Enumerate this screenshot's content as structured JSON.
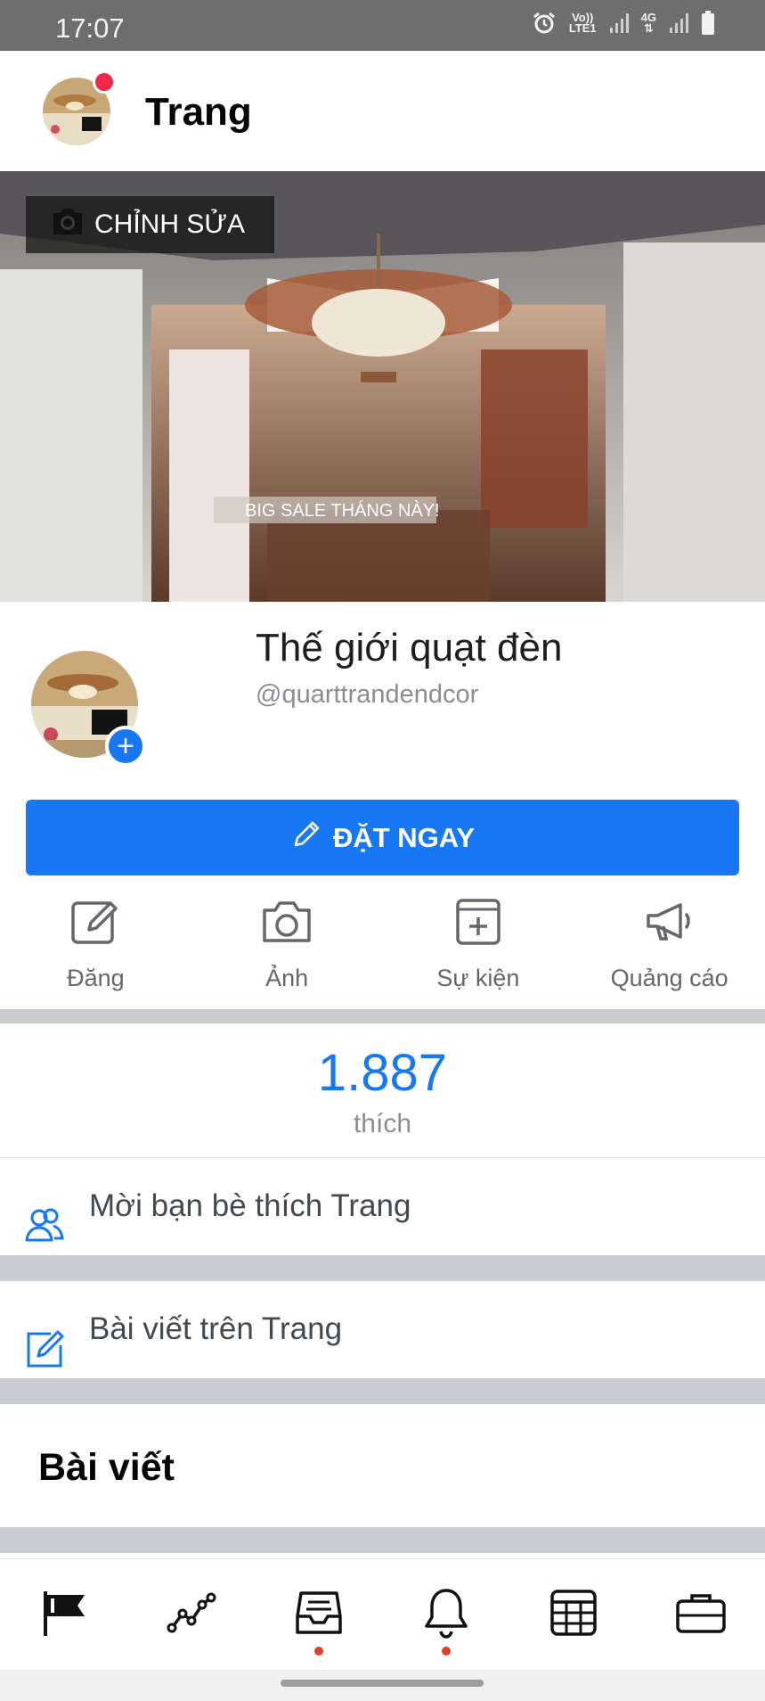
{
  "status_bar": {
    "time": "17:07",
    "volte": "Vo))",
    "lte": "LTE1",
    "network": "4G"
  },
  "header": {
    "title": "Trang",
    "notification_dot": true
  },
  "cover": {
    "edit_label": "CHỈNH SỬA",
    "overlay_text": "BIG SALE THÁNG NÀY!"
  },
  "profile": {
    "name": "Thế giới quạt đèn",
    "handle": "@quarttrandendcor",
    "add_symbol": "+"
  },
  "cta": {
    "label": "ĐẶT NGAY"
  },
  "actions": [
    {
      "label": "Đăng",
      "icon": "edit-icon"
    },
    {
      "label": "Ảnh",
      "icon": "camera-icon"
    },
    {
      "label": "Sự kiện",
      "icon": "event-add-icon"
    },
    {
      "label": "Quảng cáo",
      "icon": "megaphone-icon"
    }
  ],
  "likes": {
    "count": "1.887",
    "label": "thích"
  },
  "invite": {
    "label": "Mời bạn bè thích Trang",
    "icon": "friends-icon"
  },
  "posts_link": {
    "label": "Bài viết trên Trang",
    "icon": "compose-icon"
  },
  "section": {
    "title": "Bài viết"
  },
  "bottom_nav": [
    {
      "icon": "flag-icon",
      "badge": false
    },
    {
      "icon": "insights-icon",
      "badge": false
    },
    {
      "icon": "inbox-icon",
      "badge": true
    },
    {
      "icon": "bell-icon",
      "badge": true
    },
    {
      "icon": "calendar-grid-icon",
      "badge": false
    },
    {
      "icon": "briefcase-icon",
      "badge": false
    }
  ],
  "colors": {
    "accent": "#1877f2",
    "badge": "#e0402a",
    "separator": "#c9ccd1",
    "status_bar": "#6e6e6e"
  }
}
